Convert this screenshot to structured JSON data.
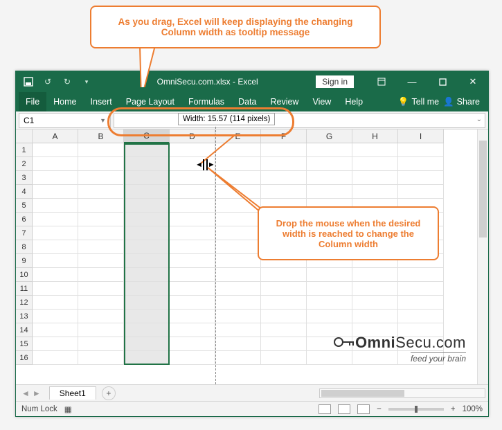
{
  "callouts": {
    "top": "As you drag, Excel will keep displaying the changing Column width as tooltip message",
    "right": "Drop the mouse when the desired width is reached to change the Column width"
  },
  "titlebar": {
    "title": "OmniSecu.com.xlsx - Excel",
    "signin": "Sign in"
  },
  "ribbon": {
    "tabs": [
      "File",
      "Home",
      "Insert",
      "Page Layout",
      "Formulas",
      "Data",
      "Review",
      "View",
      "Help"
    ],
    "tellme": "Tell me",
    "share": "Share"
  },
  "namebox": {
    "value": "C1"
  },
  "widthTooltip": "Width: 15.57 (114 pixels)",
  "columns": [
    "A",
    "B",
    "C",
    "D",
    "E",
    "F",
    "G",
    "H",
    "I"
  ],
  "rows": [
    "1",
    "2",
    "3",
    "4",
    "5",
    "6",
    "7",
    "8",
    "9",
    "10",
    "11",
    "12",
    "13",
    "14",
    "15",
    "16"
  ],
  "selectedColumnIndex": 2,
  "sheet": {
    "name": "Sheet1"
  },
  "statusbar": {
    "numlock": "Num Lock",
    "zoom": "100%"
  },
  "logo": {
    "main1": "Omni",
    "main2": "Secu.com",
    "sub": "feed your brain"
  }
}
